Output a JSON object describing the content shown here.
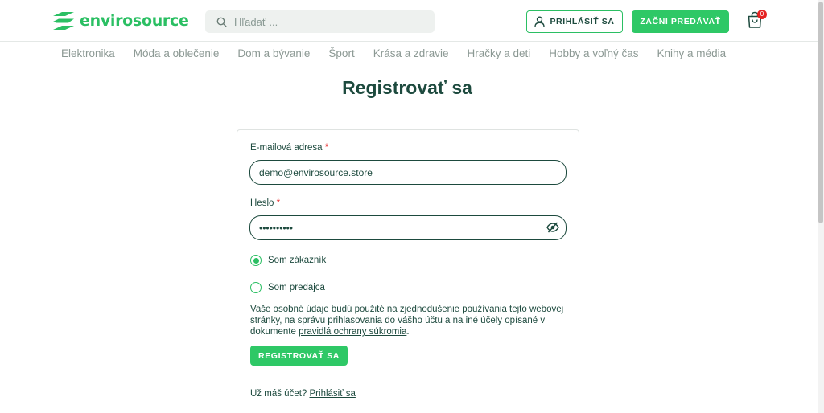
{
  "brand": {
    "name": "envirosource",
    "color": "#2bbf63"
  },
  "header": {
    "search_placeholder": "Hľadať ...",
    "login_label": "PRIHLÁSIŤ SA",
    "sell_label": "ZAČNI PREDÁVAŤ",
    "cart_count": "0"
  },
  "categories": [
    "Elektronika",
    "Móda a oblečenie",
    "Dom a bývanie",
    "Šport",
    "Krása a zdravie",
    "Hračky a deti",
    "Hobby a voľný čas",
    "Knihy a média"
  ],
  "form": {
    "title": "Registrovať sa",
    "email_label": "E-mailová adresa",
    "email_value": "demo@envirosource.store",
    "password_label": "Heslo",
    "password_value": "••••••••••",
    "required_mark": "*",
    "radio_customer": "Som zákazník",
    "radio_seller": "Som predajca",
    "selected_role": "customer",
    "privacy_text": "Vaše osobné údaje budú použité na zjednodušenie používania tejto webovej stránky, na správu prihlasovania do vášho účtu a na iné účely opísané v dokumente",
    "privacy_link": "pravidlá ochrany súkromia",
    "privacy_end": ".",
    "register_label": "REGISTROVAŤ SA",
    "have_account_text": "Už máš účet?",
    "login_link": "Prihlásiť sa"
  },
  "colors": {
    "accent": "#2ec866",
    "text_dark": "#1d4a3e",
    "required": "#e52222"
  }
}
